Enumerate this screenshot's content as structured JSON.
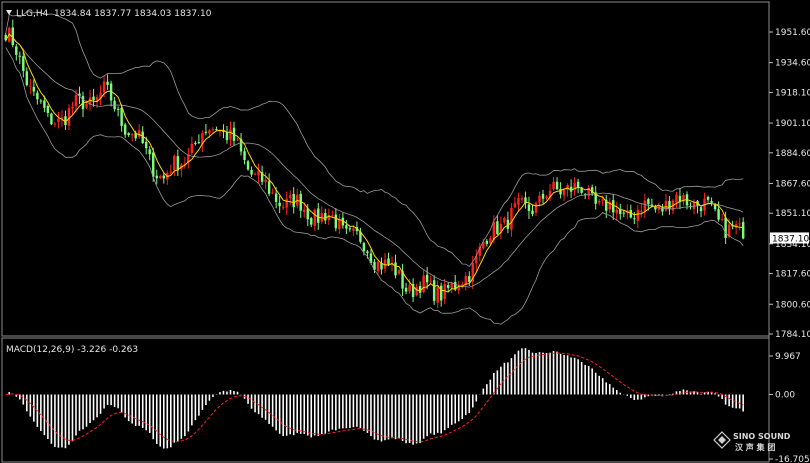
{
  "chart_data": [
    {
      "type": "candlestick",
      "title": "LLG,H4",
      "ohlc_text": "1834.84 1837.77 1834.03 1837.10",
      "last_price": 1837.1,
      "last_price_label": "1837.10",
      "ylim": [
        1784.1,
        1960.0
      ],
      "y_ticks": [
        1951.6,
        1934.6,
        1918.1,
        1901.1,
        1884.6,
        1867.6,
        1851.1,
        1834.1,
        1817.6,
        1800.6,
        1784.1
      ],
      "y_tick_labels": [
        "1951.60",
        "1934.60",
        "1918.10",
        "1901.10",
        "1884.60",
        "1867.60",
        "1851.10",
        "1834.10",
        "1817.60",
        "1800.60",
        "1784.10"
      ],
      "indicators": [
        "Bollinger Bands",
        "Moving Average"
      ],
      "colors": {
        "up": "#ff2020",
        "down": "#7CFC7C",
        "bands": "#9a9a9a",
        "ma": "#ffd700"
      },
      "key_points": [
        {
          "bar": 0,
          "close": 1952
        },
        {
          "bar": 12,
          "close": 1901
        },
        {
          "bar": 28,
          "close": 1918
        },
        {
          "bar": 45,
          "close": 1870
        },
        {
          "bar": 60,
          "close": 1902
        },
        {
          "bar": 75,
          "close": 1862
        },
        {
          "bar": 95,
          "close": 1845
        },
        {
          "bar": 115,
          "close": 1810
        },
        {
          "bar": 128,
          "close": 1808
        },
        {
          "bar": 140,
          "close": 1845
        },
        {
          "bar": 160,
          "close": 1867
        },
        {
          "bar": 175,
          "close": 1850
        },
        {
          "bar": 195,
          "close": 1860
        },
        {
          "bar": 210,
          "close": 1837
        }
      ]
    },
    {
      "type": "macd",
      "title": "MACD(12,26,9) -3.226 -0.263",
      "params": "12,26,9",
      "main_value": -3.226,
      "signal_value": -0.263,
      "ylim": [
        -16.705,
        9.967
      ],
      "y_ticks": [
        9.967,
        0.0,
        -16.705
      ],
      "y_tick_labels": [
        "9.967",
        "0.00",
        "-16.705"
      ],
      "colors": {
        "histogram": "#ffffff",
        "signal": "#ff2020"
      }
    }
  ],
  "watermark": {
    "name": "SINO SOUND",
    "subtitle": "汉 声 集 团"
  }
}
